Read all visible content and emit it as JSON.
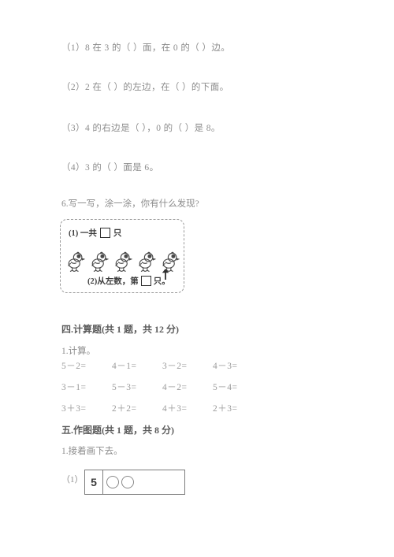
{
  "document": {
    "type": "math-worksheet",
    "language": "zh-CN"
  },
  "fill_in_blanks": {
    "items": [
      "（1）8 在 3 的（        ）面，在 0 的（        ）边。",
      "（2）2 在（        ）的左边，在（        ）的下面。",
      "（3）4 的右边是（        ），0 的（        ）是 8。",
      "（4）3 的（        ）面是 6。"
    ]
  },
  "question6": {
    "prompt": "6.写一写，涂一涂，你有什么发现?",
    "box": {
      "line1_prefix": "(1) 一共",
      "line1_suffix": "只",
      "line2_prefix": "(2)从左数，第",
      "line2_suffix": "只。",
      "chick_count": 5,
      "arrow_points_to_index": 5,
      "answer_box_placeholder": ""
    }
  },
  "section_four": {
    "heading": "四.计算题(共 1 题，共 12 分)",
    "sub_heading": "1.计算。",
    "rows": [
      [
        "5－2=",
        "4－1=",
        "3－2=",
        "4－3="
      ],
      [
        "3－1=",
        "5－3=",
        "4－2=",
        "5－4="
      ],
      [
        "3＋3=",
        "2＋2=",
        "4＋3=",
        "2＋3="
      ]
    ]
  },
  "section_five": {
    "heading": "五.作图题(共 1 题，共 8 分)",
    "sub_heading": "1.接着画下去。",
    "item_label": "（1）",
    "figure": {
      "number": "5",
      "circle_count": 2
    }
  },
  "colors": {
    "text": "#8c8c8c",
    "heading": "#5c5c5c",
    "ink": "#3d3d3d",
    "rule": "#7c7c7c",
    "page_bg": "#ffffff"
  }
}
